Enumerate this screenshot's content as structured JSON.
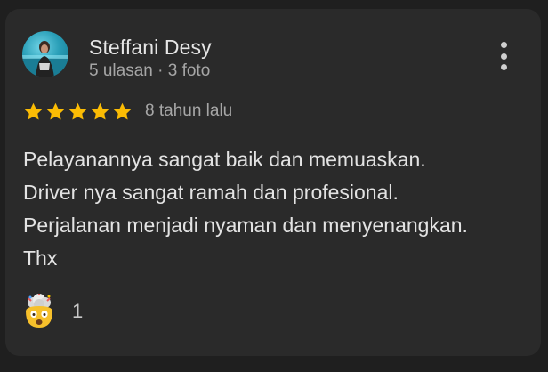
{
  "review": {
    "reviewer_name": "Steffani Desy",
    "reviewer_meta": "5 ulasan · 3 foto",
    "rating": 5,
    "rating_max": 5,
    "time_ago": "8 tahun lalu",
    "text": "Pelayanannya sangat baik dan memuaskan.\nDriver nya sangat ramah dan profesional.\nPerjalanan menjadi nyaman dan menyenangkan.\nThx",
    "reaction": {
      "icon": "exploding-head-emoji-icon",
      "count": "1"
    }
  },
  "colors": {
    "background": "#1f1f1f",
    "card": "#2a2a2a",
    "star": "#fbbc04",
    "primary_text": "#e6e6e6",
    "secondary_text": "#a6a6a6"
  }
}
